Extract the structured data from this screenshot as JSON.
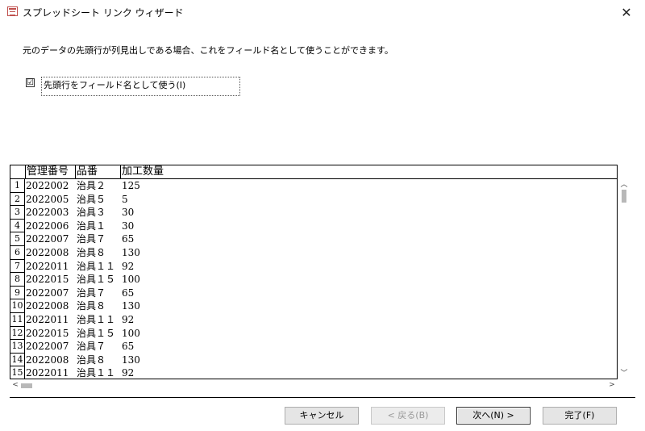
{
  "window": {
    "title": "スプレッドシート リンク ウィザード",
    "close_glyph": "✕"
  },
  "description": "元のデータの先頭行が列見出しである場合、これをフィールド名として使うことができます。",
  "checkbox": {
    "checked": true,
    "mark": "☑",
    "label": "先頭行をフィールド名として使う(I)"
  },
  "grid": {
    "columns": [
      "管理番号",
      "品番",
      "加工数量"
    ],
    "rows": [
      {
        "n": "1",
        "id": "2022002",
        "item": "治具２",
        "qty": "125"
      },
      {
        "n": "2",
        "id": "2022005",
        "item": "治具５",
        "qty": "5"
      },
      {
        "n": "3",
        "id": "2022003",
        "item": "治具３",
        "qty": "30"
      },
      {
        "n": "4",
        "id": "2022006",
        "item": "治具１",
        "qty": "30"
      },
      {
        "n": "5",
        "id": "2022007",
        "item": "治具７",
        "qty": "65"
      },
      {
        "n": "6",
        "id": "2022008",
        "item": "治具８",
        "qty": "130"
      },
      {
        "n": "7",
        "id": "2022011",
        "item": "治具１１",
        "qty": "92"
      },
      {
        "n": "8",
        "id": "2022015",
        "item": "治具１５",
        "qty": "100"
      },
      {
        "n": "9",
        "id": "2022007",
        "item": "治具７",
        "qty": "65"
      },
      {
        "n": "10",
        "id": "2022008",
        "item": "治具８",
        "qty": "130"
      },
      {
        "n": "11",
        "id": "2022011",
        "item": "治具１１",
        "qty": "92"
      },
      {
        "n": "12",
        "id": "2022015",
        "item": "治具１５",
        "qty": "100"
      },
      {
        "n": "13",
        "id": "2022007",
        "item": "治具７",
        "qty": "65"
      },
      {
        "n": "14",
        "id": "2022008",
        "item": "治具８",
        "qty": "130"
      },
      {
        "n": "15",
        "id": "2022011",
        "item": "治具１１",
        "qty": "92"
      }
    ]
  },
  "scroll": {
    "up": "︿",
    "down": "﹀",
    "left": "<",
    "right": ">"
  },
  "buttons": {
    "cancel": "キャンセル",
    "back": "< 戻る(B)",
    "next": "次へ(N) >",
    "finish": "完了(F)"
  }
}
